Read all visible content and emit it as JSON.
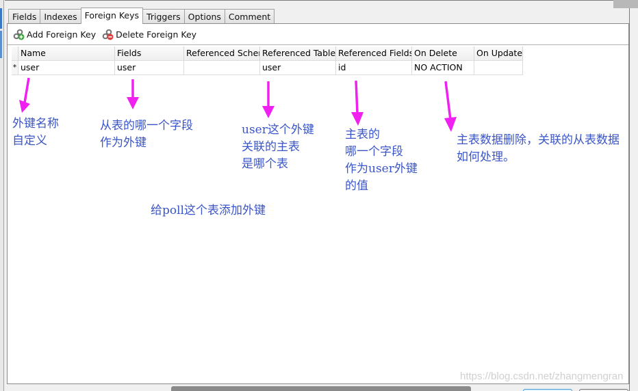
{
  "tabs": [
    {
      "label": "Fields",
      "active": false
    },
    {
      "label": "Indexes",
      "active": false
    },
    {
      "label": "Foreign Keys",
      "active": true
    },
    {
      "label": "Triggers",
      "active": false
    },
    {
      "label": "Options",
      "active": false
    },
    {
      "label": "Comment",
      "active": false
    }
  ],
  "toolbar": {
    "add_label": "Add Foreign Key",
    "add_icon": "link-add-icon",
    "delete_label": "Delete Foreign Key",
    "delete_icon": "link-delete-icon"
  },
  "table": {
    "columns": [
      "Name",
      "Fields",
      "Referenced Schem",
      "Referenced Table",
      "Referenced Fields",
      "On Delete",
      "On Update"
    ],
    "rows": [
      {
        "indicator": "*",
        "cells": [
          "user",
          "user",
          "",
          "user",
          "id",
          "NO ACTION",
          ""
        ]
      }
    ]
  },
  "annotations": {
    "name": [
      "外键名称",
      "自定义"
    ],
    "fields": [
      "从表的哪一个字段",
      "作为外键"
    ],
    "ref_table": [
      "user这个外键",
      "关联的主表",
      "是哪个表"
    ],
    "ref_fields": [
      "主表的",
      "哪一个字段",
      "作为user外键",
      "的值"
    ],
    "on_delete": [
      "主表数据删除，关联的从表数据",
      "如何处理。"
    ],
    "caption": "给poll这个表添加外键"
  },
  "colors": {
    "annotation_text": "#3a55c8",
    "arrow": "#f020f0"
  },
  "watermark": "https://blog.csdn.net/zhangmengran"
}
